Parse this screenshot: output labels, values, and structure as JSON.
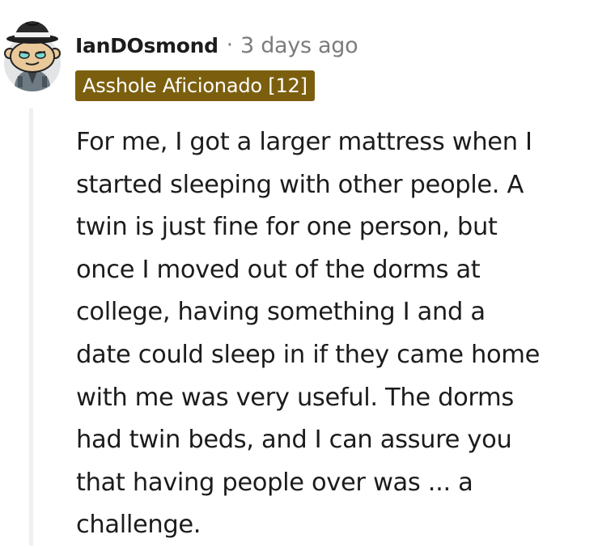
{
  "comment": {
    "username": "IanDOsmond",
    "separator": "·",
    "timestamp": "3 days ago",
    "flair": "Asshole Aficionado [12]",
    "flair_color": "#7c5f0e",
    "avatar_icon": "snoo-avatar-with-fedora-icon",
    "body_lines": [
      "For me, I got a larger mattress when I",
      "started sleeping with other people. A",
      "twin is just fine for one person, but",
      "once I moved out of the dorms at",
      "college, having something I and a",
      "date could sleep in if they came home",
      "with me was very useful. The dorms",
      "had twin beds, and I can assure you",
      "that having people over was ... a",
      "challenge."
    ]
  }
}
